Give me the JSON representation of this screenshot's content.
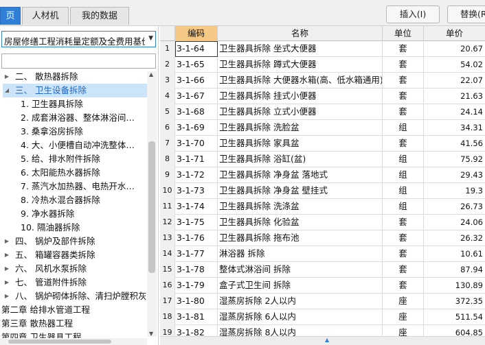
{
  "tabs": [
    {
      "label": "页"
    },
    {
      "label": "人材机"
    },
    {
      "label": "我的数据"
    }
  ],
  "toolbar": {
    "insert_label": "插入(I)",
    "replace_label": "替换(R"
  },
  "left": {
    "quota_select": "房屋修缮工程消耗量定额及全费用基价表",
    "tree": [
      {
        "label": "二、 散热器拆除",
        "twisty": "▶",
        "indent": 1
      },
      {
        "label": "三、 卫生设备拆除",
        "twisty": "◢",
        "indent": 1,
        "selected": true
      },
      {
        "label": "1.   卫生器具拆除",
        "twisty": "",
        "indent": 2
      },
      {
        "label": "2.   成套淋浴器、整体淋浴间…",
        "twisty": "",
        "indent": 2
      },
      {
        "label": "3.   桑拿浴房拆除",
        "twisty": "",
        "indent": 2
      },
      {
        "label": "4.   大、小便槽自动冲洗整体…",
        "twisty": "",
        "indent": 2
      },
      {
        "label": "5.   给、排水附件拆除",
        "twisty": "",
        "indent": 2
      },
      {
        "label": "6.   太阳能热水器拆除",
        "twisty": "",
        "indent": 2
      },
      {
        "label": "7.   蒸汽水加热器、电热开水…",
        "twisty": "",
        "indent": 2
      },
      {
        "label": "8.   冷热水混合器拆除",
        "twisty": "",
        "indent": 2
      },
      {
        "label": "9.   净水器拆除",
        "twisty": "",
        "indent": 2
      },
      {
        "label": "10.  隔油器拆除",
        "twisty": "",
        "indent": 2
      },
      {
        "label": "四、 锅炉及部件拆除",
        "twisty": "▶",
        "indent": 1
      },
      {
        "label": "五、 箱罐容器类拆除",
        "twisty": "▶",
        "indent": 1
      },
      {
        "label": "六、 风机水泵拆除",
        "twisty": "▶",
        "indent": 1
      },
      {
        "label": "七、 管道附件拆除",
        "twisty": "▶",
        "indent": 1
      },
      {
        "label": "八、 锅炉砌体拆除、清扫炉膛积灰",
        "twisty": "▶",
        "indent": 1
      },
      {
        "label": "第二章 给排水管道工程",
        "twisty": "",
        "indent": 0
      },
      {
        "label": "第三章 散热器工程",
        "twisty": "",
        "indent": 0
      },
      {
        "label": "第四章 卫生器具工程",
        "twisty": "",
        "indent": 0
      }
    ]
  },
  "table": {
    "headers": {
      "code": "编码",
      "name": "名称",
      "unit": "单位",
      "price": "单价"
    },
    "rows": [
      {
        "n": "1",
        "code": "3-1-64",
        "name": "卫生器具拆除 坐式大便器",
        "unit": "套",
        "price": "20.67"
      },
      {
        "n": "2",
        "code": "3-1-65",
        "name": "卫生器具拆除 蹲式大便器",
        "unit": "套",
        "price": "54.02"
      },
      {
        "n": "3",
        "code": "3-1-66",
        "name": "卫生器具拆除 大便器水箱(高、低水箱通用)",
        "unit": "套",
        "price": "22.07"
      },
      {
        "n": "4",
        "code": "3-1-67",
        "name": "卫生器具拆除 挂式小便器",
        "unit": "套",
        "price": "21.63"
      },
      {
        "n": "5",
        "code": "3-1-68",
        "name": "卫生器具拆除 立式小便器",
        "unit": "套",
        "price": "24.14"
      },
      {
        "n": "6",
        "code": "3-1-69",
        "name": "卫生器具拆除 洗脸盆",
        "unit": "组",
        "price": "34.31"
      },
      {
        "n": "7",
        "code": "3-1-70",
        "name": "卫生器具拆除 家具盆",
        "unit": "套",
        "price": "41.56"
      },
      {
        "n": "8",
        "code": "3-1-71",
        "name": "卫生器具拆除 浴缸(盆)",
        "unit": "组",
        "price": "75.92"
      },
      {
        "n": "9",
        "code": "3-1-72",
        "name": "卫生器具拆除 净身盆 落地式",
        "unit": "组",
        "price": "29.43"
      },
      {
        "n": "10",
        "code": "3-1-73",
        "name": "卫生器具拆除 净身盆 壁挂式",
        "unit": "组",
        "price": "19.3"
      },
      {
        "n": "11",
        "code": "3-1-74",
        "name": "卫生器具拆除 洗涤盆",
        "unit": "组",
        "price": "26.73"
      },
      {
        "n": "12",
        "code": "3-1-75",
        "name": "卫生器具拆除 化验盆",
        "unit": "套",
        "price": "24.06"
      },
      {
        "n": "13",
        "code": "3-1-76",
        "name": "卫生器具拆除 拖布池",
        "unit": "套",
        "price": "26.32"
      },
      {
        "n": "14",
        "code": "3-1-77",
        "name": "淋浴器 拆除",
        "unit": "套",
        "price": "10.61"
      },
      {
        "n": "15",
        "code": "3-1-78",
        "name": "整体式淋浴间 拆除",
        "unit": "套",
        "price": "87.94"
      },
      {
        "n": "16",
        "code": "3-1-79",
        "name": "盒子式卫生间 拆除",
        "unit": "套",
        "price": "130.89"
      },
      {
        "n": "17",
        "code": "3-1-80",
        "name": "湿蒸房拆除 2人以内",
        "unit": "座",
        "price": "372.35"
      },
      {
        "n": "18",
        "code": "3-1-81",
        "name": "湿蒸房拆除 6人以内",
        "unit": "座",
        "price": "511.54"
      },
      {
        "n": "19",
        "code": "3-1-82",
        "name": "湿蒸房拆除 8人以内",
        "unit": "座",
        "price": "604.85"
      }
    ]
  }
}
